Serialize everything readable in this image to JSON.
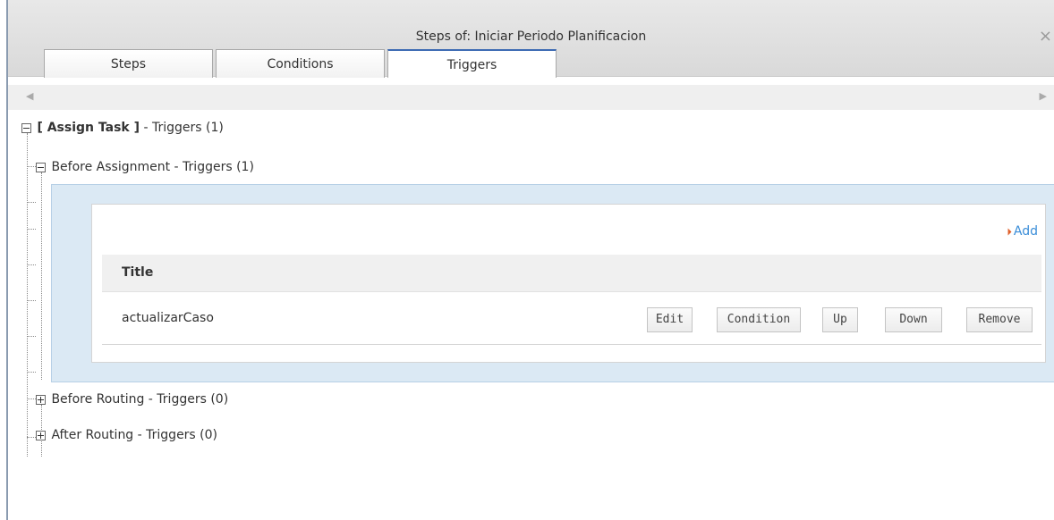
{
  "window": {
    "title": "Steps of: Iniciar Periodo Planificacion",
    "close_symbol": "×"
  },
  "tabs": [
    {
      "label": "Steps",
      "active": false
    },
    {
      "label": "Conditions",
      "active": false
    },
    {
      "label": "Triggers",
      "active": true
    }
  ],
  "scroll": {
    "left_symbol": "◀",
    "right_symbol": "▶"
  },
  "tree": {
    "root": {
      "bold_label": "[ Assign Task ]",
      "rest_label": " - Triggers (1)"
    },
    "before_assignment": {
      "label": "Before Assignment - Triggers (1)"
    },
    "before_routing": {
      "label": "Before Routing - Triggers (0)"
    },
    "after_routing": {
      "label": "After Routing - Triggers (0)"
    }
  },
  "grid": {
    "add_label": "Add",
    "add_icon": "add-arrow-icon",
    "column_title": "Title",
    "rows": [
      {
        "title": "actualizarCaso",
        "buttons": [
          "Edit",
          "Condition",
          "Up",
          "Down",
          "Remove"
        ]
      }
    ]
  },
  "colors": {
    "accent_tab": "#3d6bb3",
    "panel_bg": "#dbe9f4",
    "link": "#3a8dd8",
    "add_icon": "#e0602a"
  }
}
